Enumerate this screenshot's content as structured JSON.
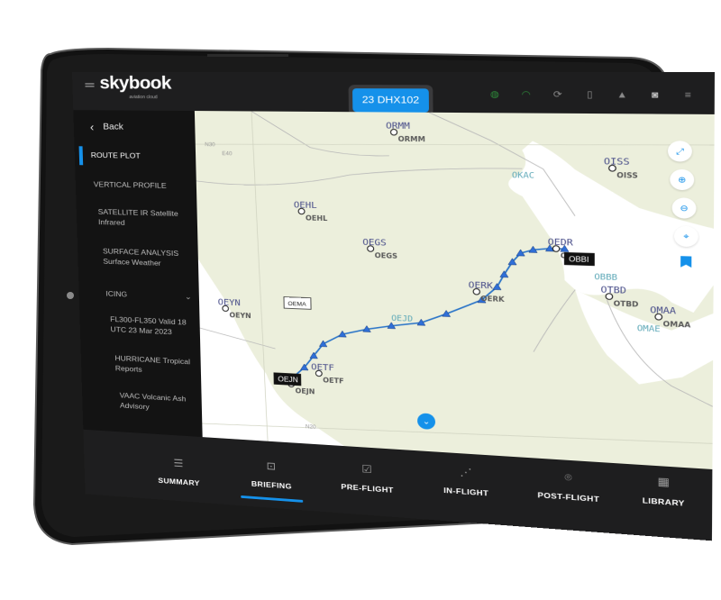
{
  "app": {
    "logo": "skybook",
    "logo_sub": "aviation cloud",
    "flight_badge": "23 DHX102"
  },
  "status_icons": [
    {
      "name": "connection-status-icon",
      "glyph": "◍",
      "color": "#2e8b3a"
    },
    {
      "name": "wifi-icon",
      "glyph": "◠",
      "color": "#2e8b3a"
    },
    {
      "name": "sync-icon",
      "glyph": "⟳",
      "color": "#8a8a8a"
    },
    {
      "name": "bookmark-icon",
      "glyph": "▯",
      "color": "#8a8a8a"
    },
    {
      "name": "notification-bell-icon",
      "glyph": "▲",
      "color": "#8a8a8a"
    },
    {
      "name": "camera-icon",
      "glyph": "◙",
      "color": "#bdbdbd"
    },
    {
      "name": "settings-sliders-icon",
      "glyph": "≡",
      "color": "#8a8a8a"
    }
  ],
  "sidebar": {
    "back_label": "Back",
    "items": [
      {
        "label": "ROUTE PLOT",
        "active": true
      },
      {
        "label": "VERTICAL PROFILE"
      },
      {
        "label": "SATELLITE IR Satellite Infrared"
      },
      {
        "label": "SURFACE ANALYSIS Surface Weather"
      },
      {
        "label": "ICING",
        "expandable": true
      },
      {
        "label": "FL300-FL350 Valid 18 UTC 23 Mar 2023"
      },
      {
        "label": "HURRICANE Tropical Reports"
      },
      {
        "label": "VAAC Volcanic Ash Advisory"
      }
    ]
  },
  "map": {
    "grid_labels": [
      "N30",
      "E40",
      "N20"
    ],
    "airports": [
      {
        "code": "ORMM",
        "sub": "ORMM"
      },
      {
        "code": "OISS",
        "sub": "OISS"
      },
      {
        "code": "OEHL",
        "sub": "OEHL"
      },
      {
        "code": "OEGS",
        "sub": "OEGS"
      },
      {
        "code": "OEYN",
        "sub": "OEYN"
      },
      {
        "code": "OERK",
        "sub": "OERK"
      },
      {
        "code": "OETF",
        "sub": "OETF"
      },
      {
        "code": "OEDR",
        "sub": "OBBI"
      },
      {
        "code": "OMAA",
        "sub": "OMAA"
      },
      {
        "code": "OTBD",
        "sub": "OTBD"
      },
      {
        "code": "OEJN",
        "sub": "OEJN"
      }
    ],
    "fir_labels": [
      "OKAC",
      "OBBB",
      "OMAE",
      "OEJD"
    ],
    "tags": {
      "origin": "OEJN",
      "destination": "OBBI",
      "fir_box": "OEMA"
    },
    "controls": [
      {
        "name": "fullscreen-button",
        "glyph": "⤢"
      },
      {
        "name": "zoom-in-button",
        "glyph": "⊕"
      },
      {
        "name": "zoom-out-button",
        "glyph": "⊖"
      },
      {
        "name": "recenter-button",
        "glyph": "⌖"
      },
      {
        "name": "bookmark-button",
        "glyph": "▮"
      }
    ],
    "collapse_glyph": "⌄"
  },
  "bottom_nav": [
    {
      "label": "SUMMARY",
      "glyph": "☰"
    },
    {
      "label": "BRIEFING",
      "glyph": "⊡",
      "active": true
    },
    {
      "label": "PRE-FLIGHT",
      "glyph": "☑"
    },
    {
      "label": "IN-FLIGHT",
      "glyph": "⋰"
    },
    {
      "label": "POST-FLIGHT",
      "glyph": "⌾"
    },
    {
      "label": "LIBRARY",
      "glyph": "▦"
    }
  ],
  "colors": {
    "accent": "#1591ea",
    "route": "#2a74c8",
    "chrome": "#1e1e1f",
    "sidebar": "#131313",
    "land": "#ecefdc",
    "water": "#ffffff"
  }
}
